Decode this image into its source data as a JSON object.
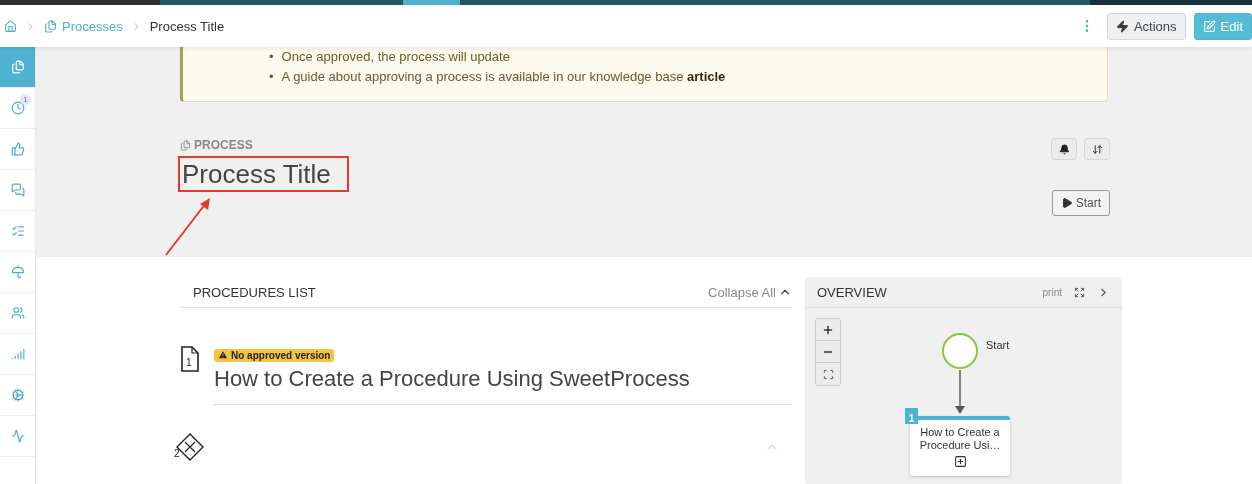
{
  "topbar": {
    "breadcrumbs": [
      {
        "label": "Processes",
        "kind": "link"
      },
      {
        "label": "Process Title",
        "kind": "current"
      }
    ],
    "actions_button": "Actions",
    "edit_button": "Edit"
  },
  "sidebar": {
    "items": [
      {
        "kind": "processes",
        "selected": true
      },
      {
        "kind": "history",
        "selected": false,
        "badge": "1"
      },
      {
        "kind": "approvals",
        "selected": false
      },
      {
        "kind": "comments",
        "selected": false
      },
      {
        "kind": "tasks",
        "selected": false
      },
      {
        "kind": "policies",
        "selected": false
      },
      {
        "kind": "team",
        "selected": false
      },
      {
        "kind": "reports",
        "selected": false
      },
      {
        "kind": "settings",
        "selected": false
      },
      {
        "kind": "activity",
        "selected": false
      }
    ]
  },
  "notice": {
    "items": [
      {
        "marker": "•",
        "text": "Once approved, the process will update"
      },
      {
        "marker": "•",
        "text": "A guide about approving a process is available in our knowledge base",
        "link": "article"
      }
    ]
  },
  "process": {
    "type_label": "PROCESS",
    "title": "Process Title",
    "start_button": "Start"
  },
  "procedures": {
    "heading": "PROCEDURES LIST",
    "collapse": "Collapse All",
    "items": [
      {
        "kind": "procedure",
        "number": "1",
        "badge": "No approved version",
        "title": "How to Create a Procedure Using SweetProcess"
      },
      {
        "kind": "decision",
        "number": "2"
      }
    ]
  },
  "overview": {
    "title": "OVERVIEW",
    "print": "print",
    "start_label": "Start",
    "node": {
      "number": "1",
      "title": "How to Create a Procedure Usi…"
    }
  }
}
